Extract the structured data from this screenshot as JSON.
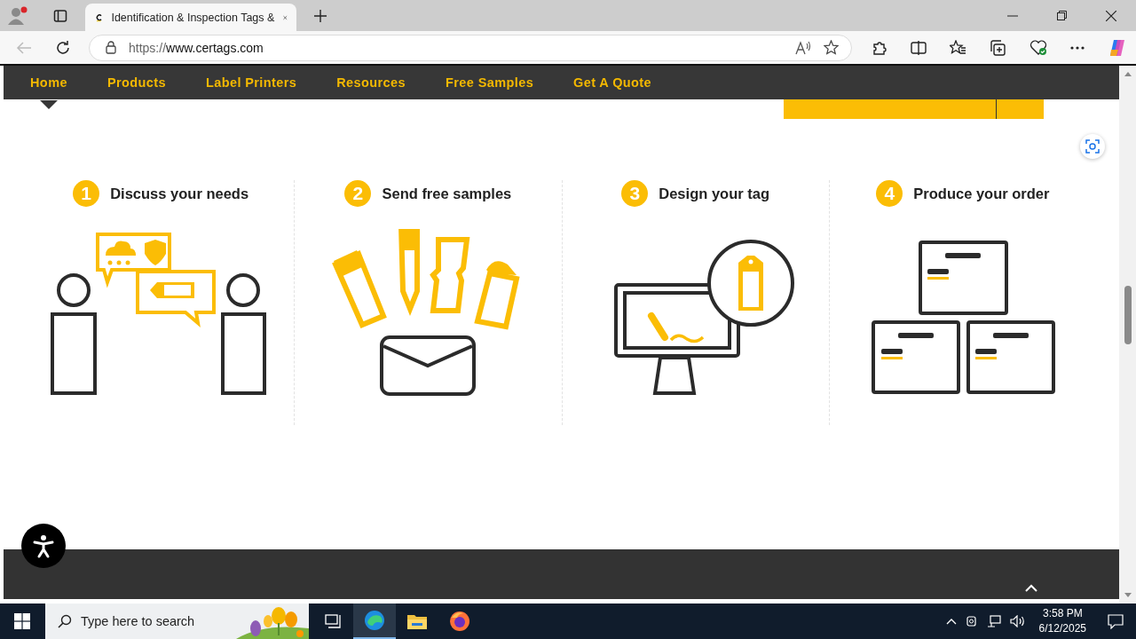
{
  "browser": {
    "tab": {
      "title": "Identification & Inspection Tags &",
      "selected": true
    },
    "url_scheme": "https://",
    "url_host": "www.certags.com"
  },
  "nav": {
    "items": [
      {
        "label": "Home",
        "selected": true
      },
      {
        "label": "Products",
        "selected": false
      },
      {
        "label": "Label Printers",
        "selected": false
      },
      {
        "label": "Resources",
        "selected": false
      },
      {
        "label": "Free Samples",
        "selected": false
      },
      {
        "label": "Get A Quote",
        "selected": false
      }
    ]
  },
  "steps": [
    {
      "number": "1",
      "title": "Discuss your needs"
    },
    {
      "number": "2",
      "title": "Send free samples"
    },
    {
      "number": "3",
      "title": "Design your tag"
    },
    {
      "number": "4",
      "title": "Produce your order"
    }
  ],
  "taskbar": {
    "search": {
      "placeholder": "Type here to search"
    },
    "time": "3:58 PM",
    "date": "6/12/2025"
  }
}
